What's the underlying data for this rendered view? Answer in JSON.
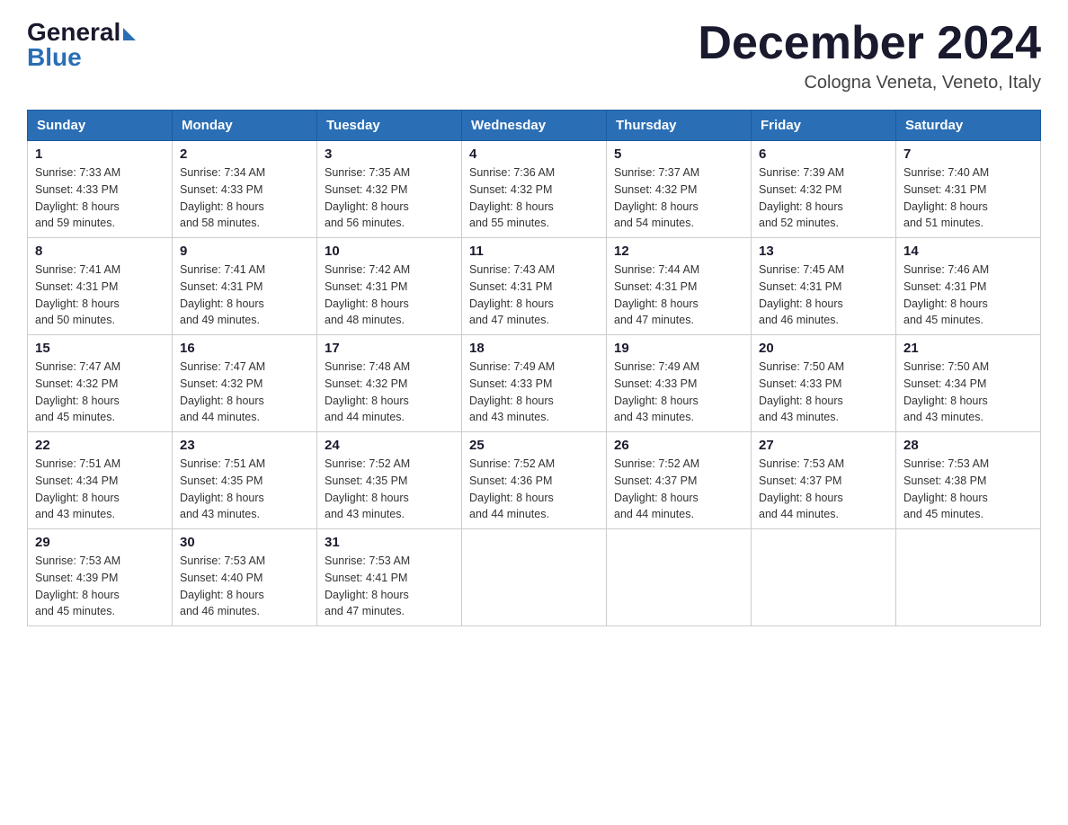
{
  "logo": {
    "general": "General",
    "blue": "Blue"
  },
  "title": "December 2024",
  "location": "Cologna Veneta, Veneto, Italy",
  "days_of_week": [
    "Sunday",
    "Monday",
    "Tuesday",
    "Wednesday",
    "Thursday",
    "Friday",
    "Saturday"
  ],
  "weeks": [
    [
      {
        "day": "1",
        "sunrise": "7:33 AM",
        "sunset": "4:33 PM",
        "daylight": "8 hours and 59 minutes."
      },
      {
        "day": "2",
        "sunrise": "7:34 AM",
        "sunset": "4:33 PM",
        "daylight": "8 hours and 58 minutes."
      },
      {
        "day": "3",
        "sunrise": "7:35 AM",
        "sunset": "4:32 PM",
        "daylight": "8 hours and 56 minutes."
      },
      {
        "day": "4",
        "sunrise": "7:36 AM",
        "sunset": "4:32 PM",
        "daylight": "8 hours and 55 minutes."
      },
      {
        "day": "5",
        "sunrise": "7:37 AM",
        "sunset": "4:32 PM",
        "daylight": "8 hours and 54 minutes."
      },
      {
        "day": "6",
        "sunrise": "7:39 AM",
        "sunset": "4:32 PM",
        "daylight": "8 hours and 52 minutes."
      },
      {
        "day": "7",
        "sunrise": "7:40 AM",
        "sunset": "4:31 PM",
        "daylight": "8 hours and 51 minutes."
      }
    ],
    [
      {
        "day": "8",
        "sunrise": "7:41 AM",
        "sunset": "4:31 PM",
        "daylight": "8 hours and 50 minutes."
      },
      {
        "day": "9",
        "sunrise": "7:41 AM",
        "sunset": "4:31 PM",
        "daylight": "8 hours and 49 minutes."
      },
      {
        "day": "10",
        "sunrise": "7:42 AM",
        "sunset": "4:31 PM",
        "daylight": "8 hours and 48 minutes."
      },
      {
        "day": "11",
        "sunrise": "7:43 AM",
        "sunset": "4:31 PM",
        "daylight": "8 hours and 47 minutes."
      },
      {
        "day": "12",
        "sunrise": "7:44 AM",
        "sunset": "4:31 PM",
        "daylight": "8 hours and 47 minutes."
      },
      {
        "day": "13",
        "sunrise": "7:45 AM",
        "sunset": "4:31 PM",
        "daylight": "8 hours and 46 minutes."
      },
      {
        "day": "14",
        "sunrise": "7:46 AM",
        "sunset": "4:31 PM",
        "daylight": "8 hours and 45 minutes."
      }
    ],
    [
      {
        "day": "15",
        "sunrise": "7:47 AM",
        "sunset": "4:32 PM",
        "daylight": "8 hours and 45 minutes."
      },
      {
        "day": "16",
        "sunrise": "7:47 AM",
        "sunset": "4:32 PM",
        "daylight": "8 hours and 44 minutes."
      },
      {
        "day": "17",
        "sunrise": "7:48 AM",
        "sunset": "4:32 PM",
        "daylight": "8 hours and 44 minutes."
      },
      {
        "day": "18",
        "sunrise": "7:49 AM",
        "sunset": "4:33 PM",
        "daylight": "8 hours and 43 minutes."
      },
      {
        "day": "19",
        "sunrise": "7:49 AM",
        "sunset": "4:33 PM",
        "daylight": "8 hours and 43 minutes."
      },
      {
        "day": "20",
        "sunrise": "7:50 AM",
        "sunset": "4:33 PM",
        "daylight": "8 hours and 43 minutes."
      },
      {
        "day": "21",
        "sunrise": "7:50 AM",
        "sunset": "4:34 PM",
        "daylight": "8 hours and 43 minutes."
      }
    ],
    [
      {
        "day": "22",
        "sunrise": "7:51 AM",
        "sunset": "4:34 PM",
        "daylight": "8 hours and 43 minutes."
      },
      {
        "day": "23",
        "sunrise": "7:51 AM",
        "sunset": "4:35 PM",
        "daylight": "8 hours and 43 minutes."
      },
      {
        "day": "24",
        "sunrise": "7:52 AM",
        "sunset": "4:35 PM",
        "daylight": "8 hours and 43 minutes."
      },
      {
        "day": "25",
        "sunrise": "7:52 AM",
        "sunset": "4:36 PM",
        "daylight": "8 hours and 44 minutes."
      },
      {
        "day": "26",
        "sunrise": "7:52 AM",
        "sunset": "4:37 PM",
        "daylight": "8 hours and 44 minutes."
      },
      {
        "day": "27",
        "sunrise": "7:53 AM",
        "sunset": "4:37 PM",
        "daylight": "8 hours and 44 minutes."
      },
      {
        "day": "28",
        "sunrise": "7:53 AM",
        "sunset": "4:38 PM",
        "daylight": "8 hours and 45 minutes."
      }
    ],
    [
      {
        "day": "29",
        "sunrise": "7:53 AM",
        "sunset": "4:39 PM",
        "daylight": "8 hours and 45 minutes."
      },
      {
        "day": "30",
        "sunrise": "7:53 AM",
        "sunset": "4:40 PM",
        "daylight": "8 hours and 46 minutes."
      },
      {
        "day": "31",
        "sunrise": "7:53 AM",
        "sunset": "4:41 PM",
        "daylight": "8 hours and 47 minutes."
      },
      null,
      null,
      null,
      null
    ]
  ],
  "labels": {
    "sunrise": "Sunrise:",
    "sunset": "Sunset:",
    "daylight": "Daylight:"
  }
}
